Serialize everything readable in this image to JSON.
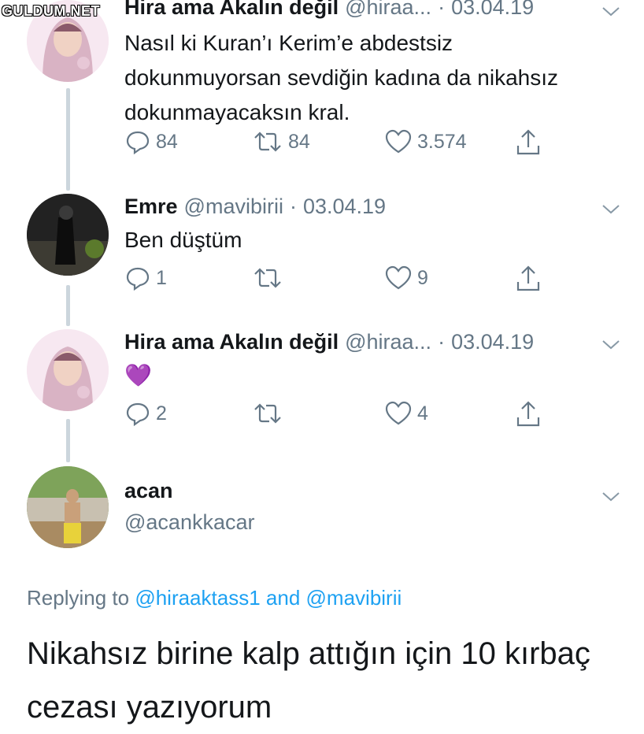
{
  "watermark": "GULDUM.NET",
  "tweets": [
    {
      "name": "Hira ama Akalın değil",
      "handle": "@hiraa...",
      "separator": "·",
      "date": "03.04.19",
      "text_lines": [
        "Nasıl ki Kuran’ı Kerim’e abdestsiz",
        "dokunmuyorsan sevdiğin kadına da nikahsız",
        "dokunmayacaksın kral."
      ],
      "replies": "84",
      "retweets": "84",
      "likes": "3.574"
    },
    {
      "name": "Emre",
      "handle": "@mavibirii",
      "separator": "·",
      "date": "03.04.19",
      "text_lines": [
        "Ben düştüm"
      ],
      "replies": "1",
      "retweets": "",
      "likes": "9"
    },
    {
      "name": "Hira ama Akalın değil",
      "handle": "@hiraa...",
      "separator": "·",
      "date": "03.04.19",
      "text_lines": [
        "💜"
      ],
      "replies": "2",
      "retweets": "",
      "likes": "4"
    }
  ],
  "main_tweet": {
    "name": "acan",
    "handle": "@acankkacar",
    "replying_prefix": "Replying to",
    "mention_1": "@hiraaktass1",
    "conjunction": "and",
    "mention_2": "@mavibirii",
    "text_lines": [
      "Nikahsız birine kalp attığın için 10 kırbaç",
      "cezası yazıyorum"
    ]
  },
  "icons": {
    "reply": "reply-icon",
    "retweet": "retweet-icon",
    "like": "heart-icon",
    "share": "share-icon",
    "caret": "chevron-down-icon"
  },
  "colors": {
    "text": "#14171a",
    "secondary": "#657786",
    "link": "#1da1f2",
    "thread_line": "#ccd6dd",
    "heart_emoji": "#9b4dca"
  }
}
